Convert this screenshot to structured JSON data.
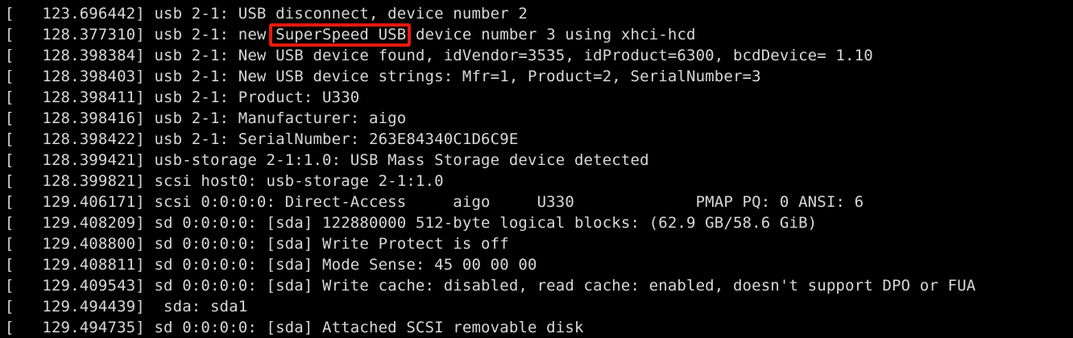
{
  "terminal": {
    "highlight_color": "#e8190f",
    "text_color": "#d8d8d8",
    "background": "#000000",
    "lines": [
      {
        "ts": "[   123.696442] ",
        "msg": "usb 2-1: USB disconnect, device number 2"
      },
      {
        "ts": "[   128.377310] ",
        "pre": "usb 2-1: new ",
        "hl": "SuperSpeed USB",
        "post": " device number 3 using xhci-hcd"
      },
      {
        "ts": "[   128.398384] ",
        "msg": "usb 2-1: New USB device found, idVendor=3535, idProduct=6300, bcdDevice= 1.10"
      },
      {
        "ts": "[   128.398403] ",
        "msg": "usb 2-1: New USB device strings: Mfr=1, Product=2, SerialNumber=3"
      },
      {
        "ts": "[   128.398411] ",
        "msg": "usb 2-1: Product: U330"
      },
      {
        "ts": "[   128.398416] ",
        "msg": "usb 2-1: Manufacturer: aigo"
      },
      {
        "ts": "[   128.398422] ",
        "msg": "usb 2-1: SerialNumber: 263E84340C1D6C9E"
      },
      {
        "ts": "[   128.399421] ",
        "msg": "usb-storage 2-1:1.0: USB Mass Storage device detected"
      },
      {
        "ts": "[   128.399821] ",
        "msg": "scsi host0: usb-storage 2-1:1.0"
      },
      {
        "ts": "[   129.406171] ",
        "msg": "scsi 0:0:0:0: Direct-Access     aigo     U330             PMAP PQ: 0 ANSI: 6"
      },
      {
        "ts": "[   129.408209] ",
        "msg": "sd 0:0:0:0: [sda] 122880000 512-byte logical blocks: (62.9 GB/58.6 GiB)"
      },
      {
        "ts": "[   129.408800] ",
        "msg": "sd 0:0:0:0: [sda] Write Protect is off"
      },
      {
        "ts": "[   129.408811] ",
        "msg": "sd 0:0:0:0: [sda] Mode Sense: 45 00 00 00"
      },
      {
        "ts": "[   129.409543] ",
        "msg": "sd 0:0:0:0: [sda] Write cache: disabled, read cache: enabled, doesn't support DPO or FUA"
      },
      {
        "ts": "[   129.494439] ",
        "msg": " sda: sda1"
      },
      {
        "ts": "[   129.494735] ",
        "msg": "sd 0:0:0:0: [sda] Attached SCSI removable disk"
      }
    ]
  }
}
